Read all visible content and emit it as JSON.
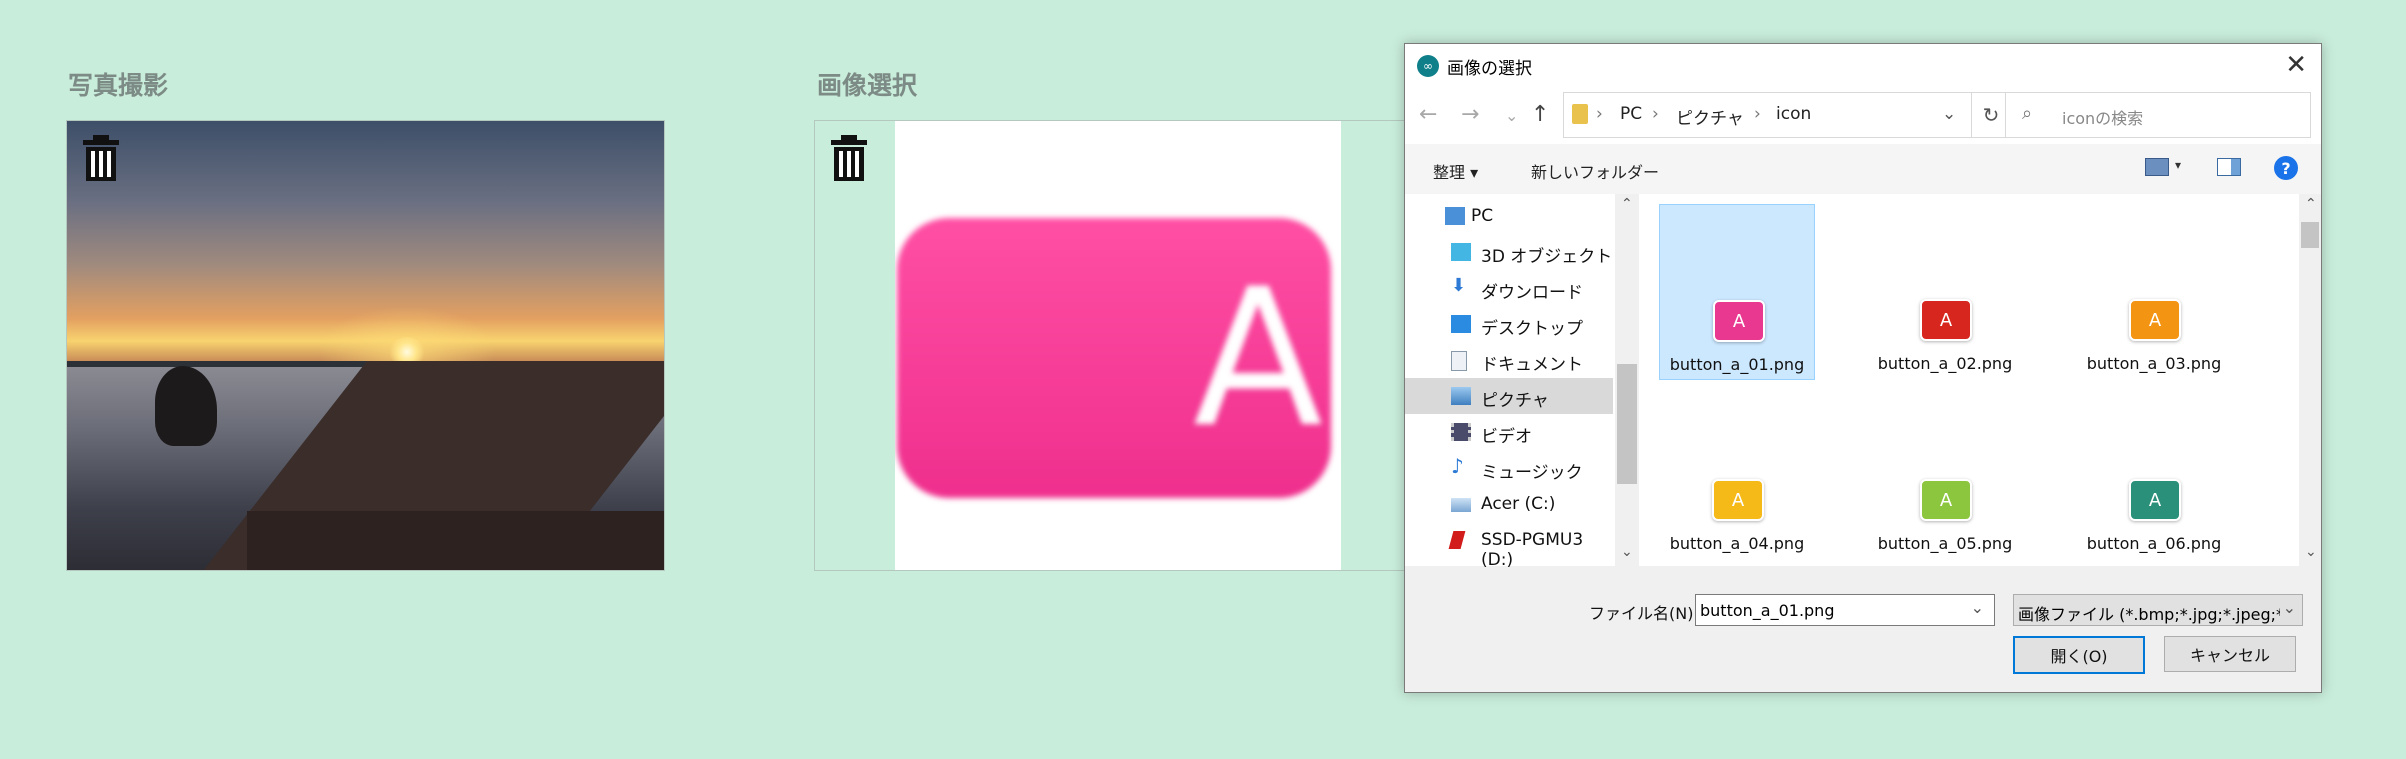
{
  "sections": {
    "photo_title": "写真撮影",
    "pick_title": "画像選択",
    "preview_letter": "A"
  },
  "dialog": {
    "title": "画像の選択",
    "app_icon": "∞",
    "close": "✕",
    "nav": {
      "back": "←",
      "forward": "→",
      "recent": "⌄",
      "up": "↑"
    },
    "breadcrumb": [
      "PC",
      "ピクチャ",
      "icon"
    ],
    "refresh": "↻",
    "search_placeholder": "iconの検索",
    "toolbar": {
      "organize": "整理 ▾",
      "new_folder": "新しいフォルダー",
      "help": "?"
    },
    "tree": [
      {
        "label": "PC",
        "icon": "pc-icon"
      },
      {
        "label": "3D オブジェクト",
        "icon": "3d-objects-icon"
      },
      {
        "label": "ダウンロード",
        "icon": "download-icon"
      },
      {
        "label": "デスクトップ",
        "icon": "desktop-icon"
      },
      {
        "label": "ドキュメント",
        "icon": "document-icon"
      },
      {
        "label": "ピクチャ",
        "icon": "pictures-icon"
      },
      {
        "label": "ビデオ",
        "icon": "video-icon"
      },
      {
        "label": "ミュージック",
        "icon": "music-icon"
      },
      {
        "label": "Acer (C:)",
        "icon": "drive-icon"
      },
      {
        "label": "SSD-PGMU3 (D:)",
        "icon": "usb-drive-icon"
      }
    ],
    "files": [
      {
        "name": "button_a_01.png",
        "letter": "A",
        "color": "#e8388f"
      },
      {
        "name": "button_a_02.png",
        "letter": "A",
        "color": "#d7261d"
      },
      {
        "name": "button_a_03.png",
        "letter": "A",
        "color": "#f39413"
      },
      {
        "name": "button_a_04.png",
        "letter": "A",
        "color": "#f5b918"
      },
      {
        "name": "button_a_05.png",
        "letter": "A",
        "color": "#8cc63e"
      },
      {
        "name": "button_a_06.png",
        "letter": "A",
        "color": "#2b9079"
      }
    ],
    "filename_label": "ファイル名(N):",
    "filename_value": "button_a_01.png",
    "filetype_value": "画像ファイル (*.bmp;*.jpg;*.jpeg;*",
    "open_label": "開く(O)",
    "cancel_label": "キャンセル"
  }
}
